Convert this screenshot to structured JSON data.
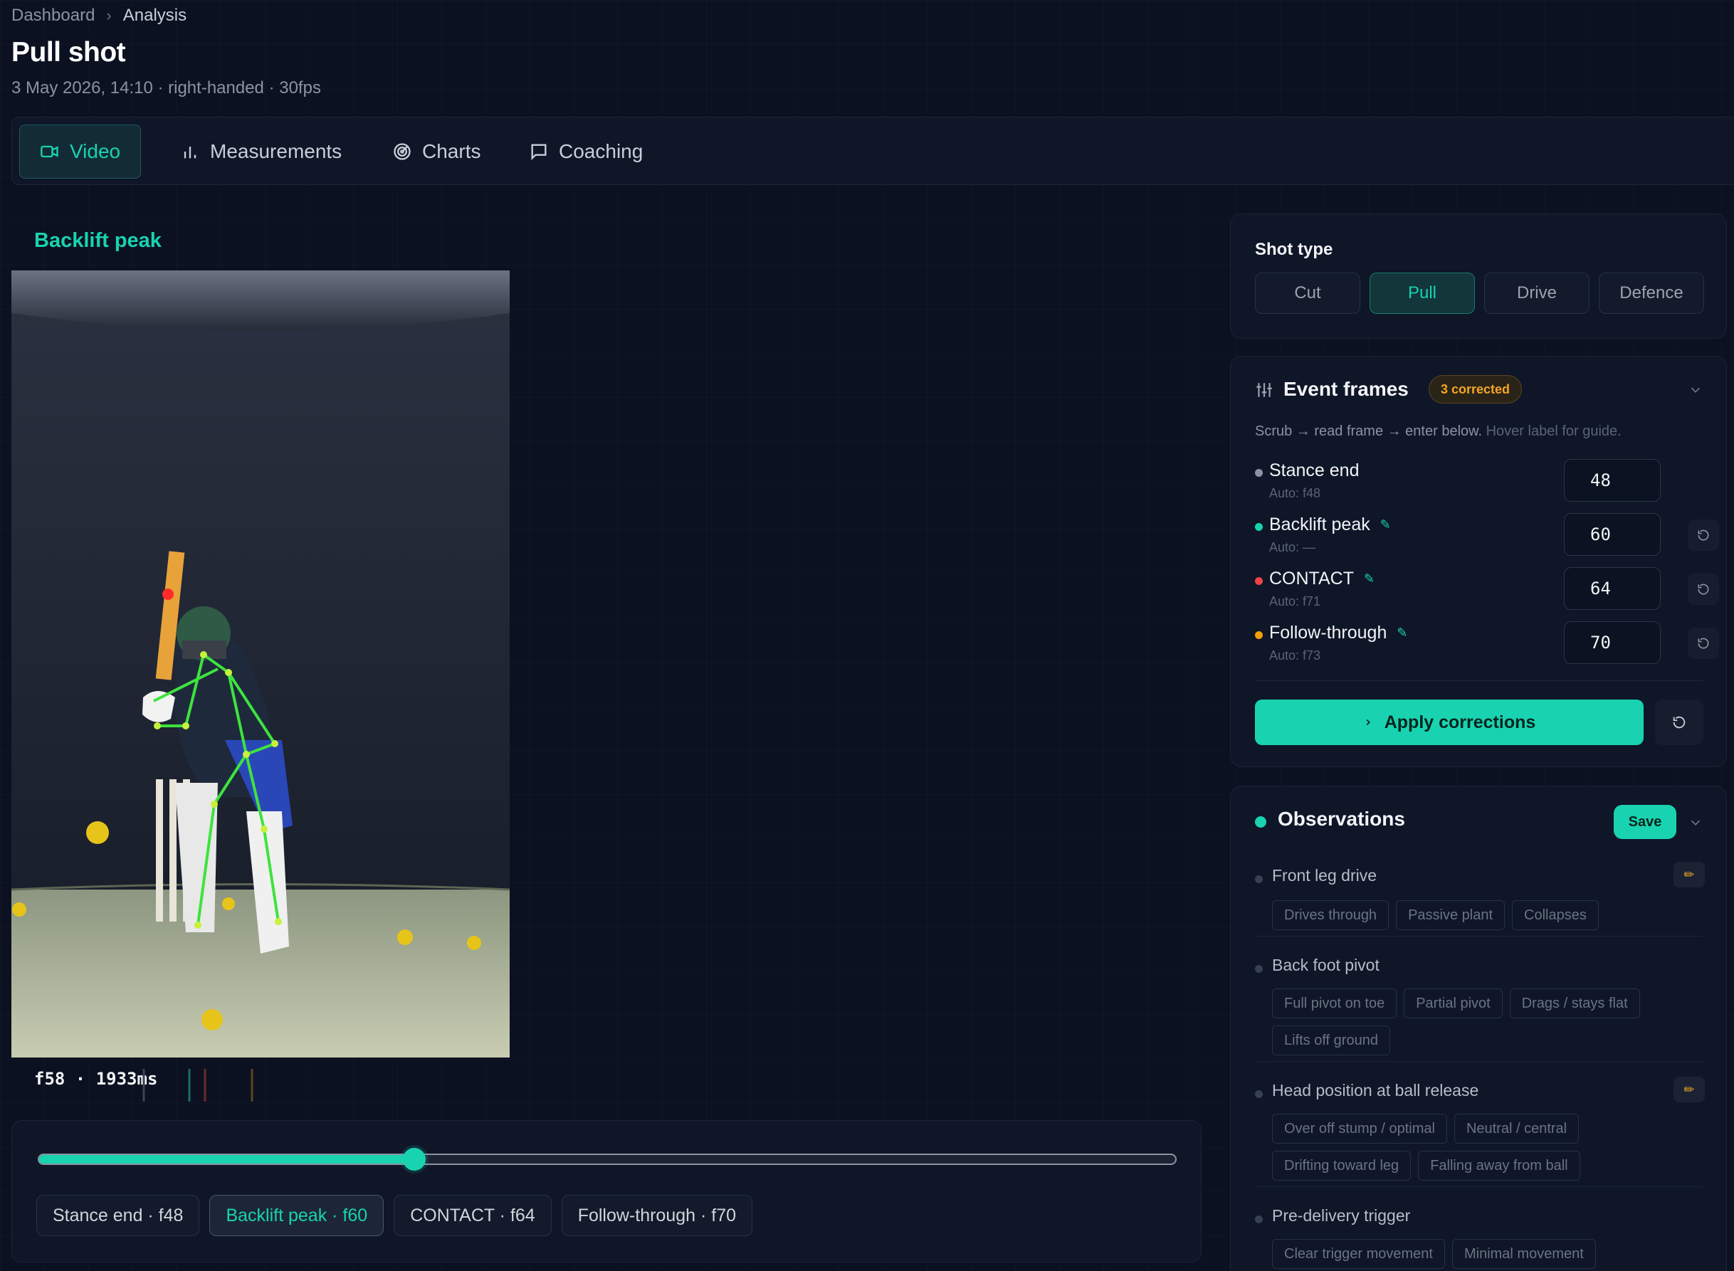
{
  "breadcrumb": {
    "root": "Dashboard",
    "separator": "›",
    "current": "Analysis"
  },
  "page": {
    "title": "Pull shot",
    "subtitle": "3 May 2026, 14:10 · right-handed · 30fps"
  },
  "tabs": [
    {
      "label": "Video",
      "icon": "video-camera-icon",
      "active": true
    },
    {
      "label": "Measurements",
      "icon": "bar-chart-icon",
      "active": false
    },
    {
      "label": "Charts",
      "icon": "radar-icon",
      "active": false
    },
    {
      "label": "Coaching",
      "icon": "chat-bubble-icon",
      "active": false
    }
  ],
  "video": {
    "event_label": "Backlift peak",
    "frame_readout": "f58 · 1933ms",
    "scrubber_progress": 0.33
  },
  "event_chips": [
    {
      "label": "Stance end · f48",
      "active": false
    },
    {
      "label": "Backlift peak · f60",
      "active": true
    },
    {
      "label": "CONTACT · f64",
      "active": false
    },
    {
      "label": "Follow-through · f70",
      "active": false
    }
  ],
  "shot_type": {
    "title": "Shot type",
    "options": [
      "Cut",
      "Pull",
      "Drive",
      "Defence"
    ],
    "selected": "Pull"
  },
  "event_frames": {
    "title": "Event frames",
    "badge": "3 corrected",
    "hint": "Scrub → read frame → enter below.",
    "hint_dim": "Hover label for guide.",
    "rows": [
      {
        "label": "Stance end",
        "auto": "Auto: f48",
        "value": "48",
        "color": "#8b93a3",
        "edited": false
      },
      {
        "label": "Backlift peak",
        "auto": "Auto: —",
        "value": "60",
        "color": "#19d3b0",
        "edited": true
      },
      {
        "label": "CONTACT",
        "auto": "Auto: f71",
        "value": "64",
        "color": "#ef4444",
        "edited": true
      },
      {
        "label": "Follow-through",
        "auto": "Auto: f73",
        "value": "70",
        "color": "#f59e0b",
        "edited": true
      }
    ],
    "apply_label": "Apply corrections"
  },
  "observations": {
    "title": "Observations",
    "save_label": "Save",
    "questions": [
      {
        "label": "Front leg drive",
        "editable": true,
        "options": [
          "Drives through",
          "Passive plant",
          "Collapses"
        ]
      },
      {
        "label": "Back foot pivot",
        "editable": false,
        "options": [
          "Full pivot on toe",
          "Partial pivot",
          "Drags / stays flat",
          "Lifts off ground"
        ]
      },
      {
        "label": "Head position at ball release",
        "editable": true,
        "options": [
          "Over off stump / optimal",
          "Neutral / central",
          "Drifting toward leg",
          "Falling away from ball"
        ]
      },
      {
        "label": "Pre-delivery trigger",
        "editable": false,
        "options": [
          "Clear trigger movement",
          "Minimal movement"
        ]
      }
    ]
  },
  "colors": {
    "accent": "#19d3b0",
    "warning": "#f5a524",
    "background": "#0b1120",
    "card": "#0e1628"
  }
}
